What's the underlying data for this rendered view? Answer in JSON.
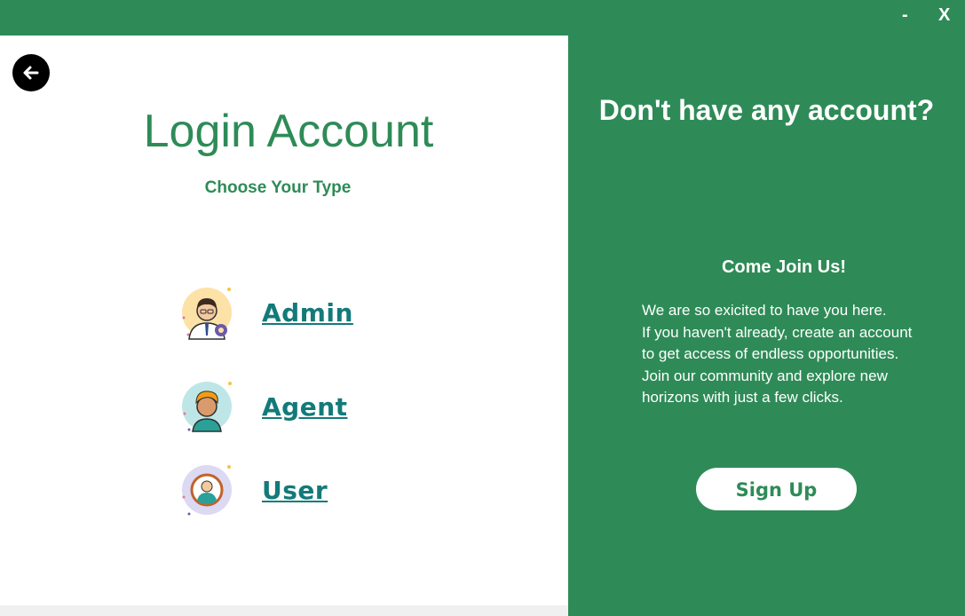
{
  "window": {
    "minimize_label": "-",
    "close_label": "X"
  },
  "login": {
    "title": "Login Account",
    "subtitle": "Choose Your Type",
    "back_icon": "arrow-left-icon",
    "roles": [
      {
        "label": "Admin",
        "icon": "admin-avatar-icon"
      },
      {
        "label": "Agent",
        "icon": "agent-avatar-icon"
      },
      {
        "label": "User",
        "icon": "user-avatar-icon"
      }
    ]
  },
  "signup_panel": {
    "heading": "Don't have any account?",
    "join_title": "Come Join Us!",
    "join_lines": [
      "We are so exicited to have you here.",
      "If you haven't already, create an account",
      "to get access of endless opportunities.",
      "Join our community and explore new",
      "horizons with just a few clicks."
    ],
    "signup_label": "Sign Up"
  },
  "colors": {
    "brand_green": "#2e8b57",
    "link_teal": "#137a7a",
    "white": "#ffffff"
  }
}
